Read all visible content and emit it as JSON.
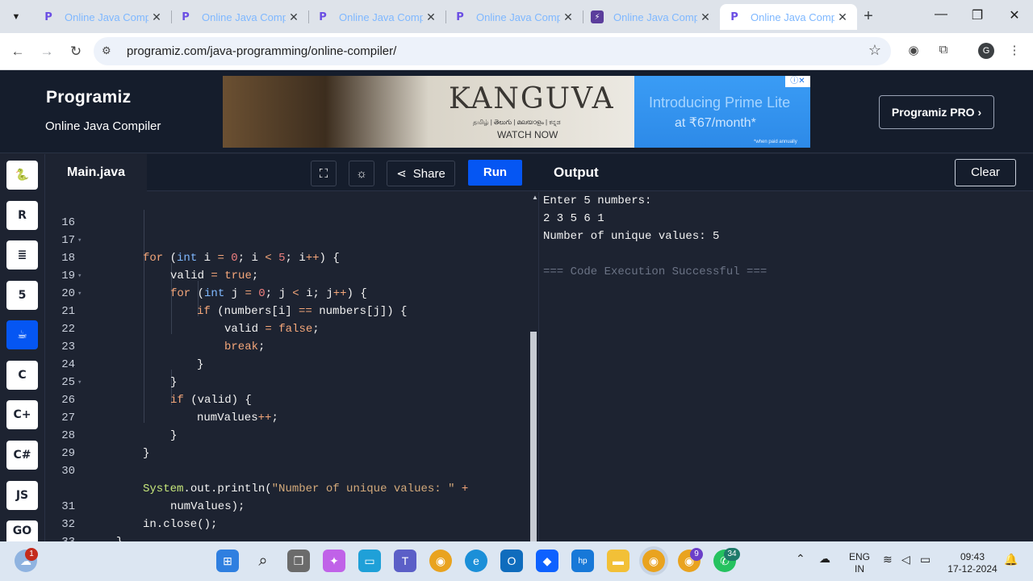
{
  "browser": {
    "tabs": [
      {
        "title": "Online Java Compi",
        "favicon": "programiz-favicon"
      },
      {
        "title": "Online Java Comp",
        "favicon": "programiz-favicon"
      },
      {
        "title": "Online Java Comp",
        "favicon": "programiz-favicon"
      },
      {
        "title": "Online Java Comp",
        "favicon": "programiz-favicon"
      },
      {
        "title": "Online Java Comp",
        "favicon": "bolt-favicon"
      },
      {
        "title": "Online Java Compi",
        "favicon": "programiz-favicon"
      }
    ],
    "url": "programiz.com/java-programming/online-compiler/",
    "profile_initial": "G"
  },
  "header": {
    "logo": "Programiz",
    "subtitle": "Online Java Compiler",
    "pro_button": "Programiz PRO ›"
  },
  "ad": {
    "kanguva": "KANGUVA",
    "languages": "தமிழ் | తెలుగు | മലയാളം | ಕನ್ನಡ",
    "watch": "WATCH NOW",
    "prime": "Introducing Prime Lite",
    "price": "at ₹67/month*",
    "note": "*when paid annually"
  },
  "sidebar": {
    "languages": [
      "python-icon",
      "r-icon",
      "sql-icon",
      "html-icon",
      "java-icon",
      "c-icon",
      "cpp-icon",
      "csharp-icon",
      "js-icon",
      "go-icon"
    ],
    "js_label": "JS",
    "go_label": "GO"
  },
  "toolbar": {
    "file_tab": "Main.java",
    "share_label": "Share",
    "run_label": "Run",
    "output_title": "Output",
    "clear_label": "Clear"
  },
  "editor": {
    "lines": [
      {
        "num": "16",
        "fold": false
      },
      {
        "num": "17",
        "fold": true
      },
      {
        "num": "18",
        "fold": false
      },
      {
        "num": "19",
        "fold": true
      },
      {
        "num": "20",
        "fold": true
      },
      {
        "num": "21",
        "fold": false
      },
      {
        "num": "22",
        "fold": false
      },
      {
        "num": "23",
        "fold": false
      },
      {
        "num": "24",
        "fold": false
      },
      {
        "num": "25",
        "fold": true
      },
      {
        "num": "26",
        "fold": false
      },
      {
        "num": "27",
        "fold": false
      },
      {
        "num": "28",
        "fold": false
      },
      {
        "num": "29",
        "fold": false
      },
      {
        "num": "30",
        "fold": false
      },
      {
        "num": "",
        "fold": false
      },
      {
        "num": "31",
        "fold": false
      },
      {
        "num": "32",
        "fold": false
      },
      {
        "num": "33",
        "fold": false
      }
    ],
    "code": {
      "l17_for": "for",
      "l17_int": "int",
      "l17_a": " i ",
      "l17_eq": "=",
      "l17_zero": "0",
      "l17_b": "; i ",
      "l17_lt": "<",
      "l17_five": "5",
      "l17_c": "; i",
      "l17_pp": "++",
      "l17_d": ") {",
      "l18_valid": "valid ",
      "l18_eq": "=",
      "l18_true": "true",
      "l18_semi": ";",
      "l19_for": "for",
      "l19_int": "int",
      "l19_a": " j ",
      "l19_eq": "=",
      "l19_zero": "0",
      "l19_b": "; j ",
      "l19_lt": "<",
      "l19_c": " i; j",
      "l19_pp": "++",
      "l19_d": ") {",
      "l20_if": "if",
      "l20_a": " (numbers[i] ",
      "l20_eq": "==",
      "l20_b": " numbers[j]) {",
      "l21_valid": "valid ",
      "l21_eq": "=",
      "l21_false": "false",
      "l21_semi": ";",
      "l22_break": "break",
      "l22_semi": ";",
      "l23": "}",
      "l24": "}",
      "l25_if": "if",
      "l25_a": " (valid) {",
      "l26_a": "numValues",
      "l26_pp": "++",
      "l26_semi": ";",
      "l27": "}",
      "l28": "}",
      "l30_sys": "System",
      "l30_out": ".out.println(",
      "l30_str": "\"Number of unique values: \"",
      "l30_plus": " +",
      "l30b": "numValues);",
      "l31": "in.close();",
      "l32": "}",
      "l33": "}"
    }
  },
  "output": {
    "lines": [
      "Enter 5 numbers:",
      "2 3 5 6 1",
      "Number of unique values: 5",
      "",
      "=== Code Execution Successful ==="
    ]
  },
  "taskbar": {
    "weather_badge": "1",
    "chrome_badge": "9",
    "whatsapp_badge": "34",
    "lang_top": "ENG",
    "lang_bottom": "IN",
    "time": "09:43",
    "date": "17-12-2024"
  }
}
